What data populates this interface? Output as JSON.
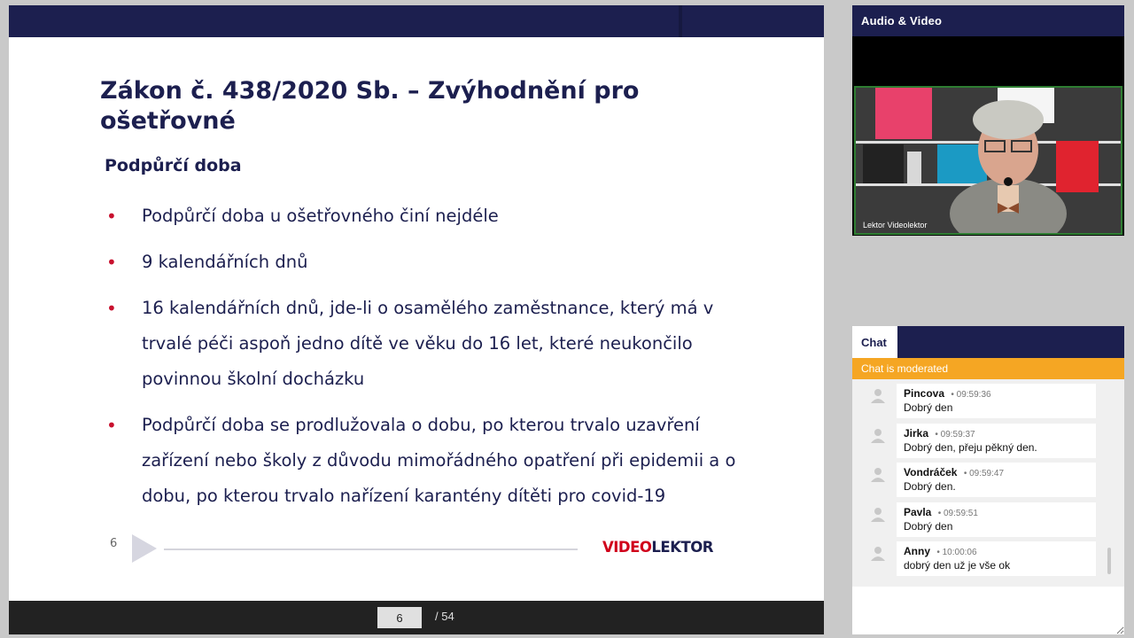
{
  "slide": {
    "title": "Zákon č. 438/2020 Sb. – Zvýhodnění pro ošetřovné",
    "subtitle": "Podpůrčí doba",
    "bullets": [
      "Podpůrčí doba u ošetřovného činí nejdéle",
      "9 kalendářních dnů",
      "16 kalendářních dnů, jde-li o osamělého zaměstnance, který má v trvalé péči aspoň jedno dítě ve věku do 16 let, které neukončilo povinnou školní docházku",
      "Podpůrčí doba se prodlužovala o dobu, po kterou trvalo uzavření zařízení nebo školy z důvodu mimořádného opatření při epidemii a o dobu, po kterou trvalo nařízení karantény dítěti pro covid-19"
    ],
    "page_number": "6",
    "logo_part1": "VIDEO",
    "logo_part2": "LEKTOR",
    "colors": {
      "navy": "#1c1f4f",
      "bullet_red": "#c8102e",
      "logo_red": "#d0021b"
    }
  },
  "pager": {
    "current_page": "6",
    "total": "/ 54"
  },
  "av_panel": {
    "title": "Audio & Video",
    "video_caption": "Lektor Videolektor"
  },
  "chat": {
    "tab_label": "Chat",
    "moderated_notice": "Chat is moderated",
    "accent_color": "#f5a623",
    "messages": [
      {
        "author": "Pincova",
        "time": "09:59:36",
        "text": "Dobrý den"
      },
      {
        "author": "Jirka",
        "time": "09:59:37",
        "text": "Dobrý den, přeju pěkný den."
      },
      {
        "author": "Vondráček",
        "time": "09:59:47",
        "text": "Dobrý den."
      },
      {
        "author": "Pavla",
        "time": "09:59:51",
        "text": "Dobrý den"
      },
      {
        "author": "Anny",
        "time": "10:00:06",
        "text": "dobrý den už je vše ok"
      }
    ]
  }
}
